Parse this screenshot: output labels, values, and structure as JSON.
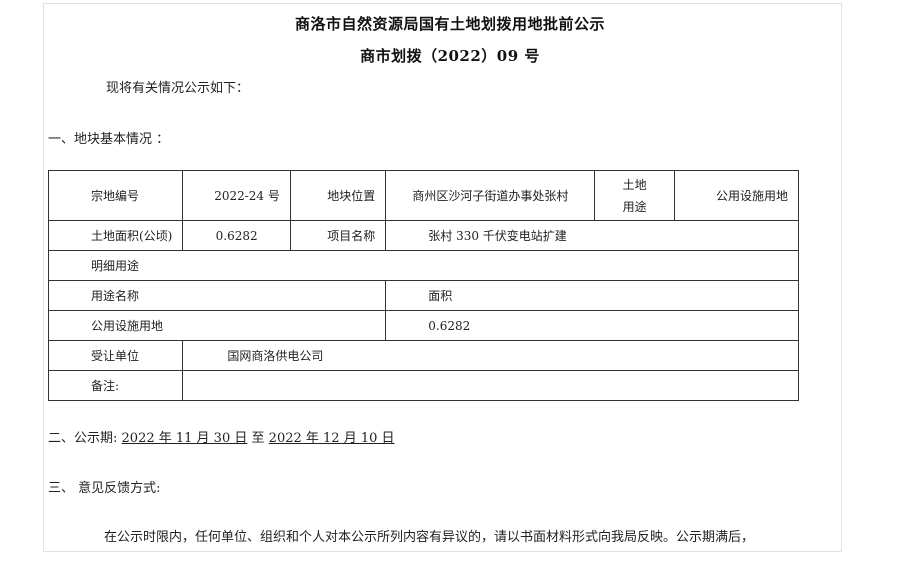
{
  "header": {
    "title": "商洛市自然资源局国有土地划拨用地批前公示",
    "doc_number": "商市划拨（2022）09 号"
  },
  "intro": "现将有关情况公示如下：",
  "section1": {
    "heading": "一、地块基本情况 ："
  },
  "table": {
    "parcel_no_label": "宗地编号",
    "parcel_no_value": "2022-24 号",
    "location_label": "地块位置",
    "location_value": "商州区沙河子街道办事处张村",
    "use_label_line1": "土地",
    "use_label_line2": "用途",
    "use_value": "公用设施用地",
    "area_label": "土地面积(公顷)",
    "area_value": "0.6282",
    "project_label": "项目名称",
    "project_value": "张村 330 千伏变电站扩建",
    "detail_use_label": "明细用途",
    "use_name_header": "用途名称",
    "area_header": "面积",
    "detail_use_name": "公用设施用地",
    "detail_area": "0.6282",
    "grantee_label": "受让单位",
    "grantee_value": "国网商洛供电公司",
    "remarks_label": "备注:",
    "remarks_value": ""
  },
  "section2": {
    "prefix": "二、公示期:",
    "start_date": "2022 年 11 月 30 日",
    "connector": "至",
    "end_date": "2022 年 12 月 10 日"
  },
  "section3": {
    "heading": "三、  意见反馈方式:"
  },
  "body_text": "在公示时限内，任何单位、组织和个人对本公示所列内容有异议的，请以书面材料形式向我局反映。公示期满后，"
}
